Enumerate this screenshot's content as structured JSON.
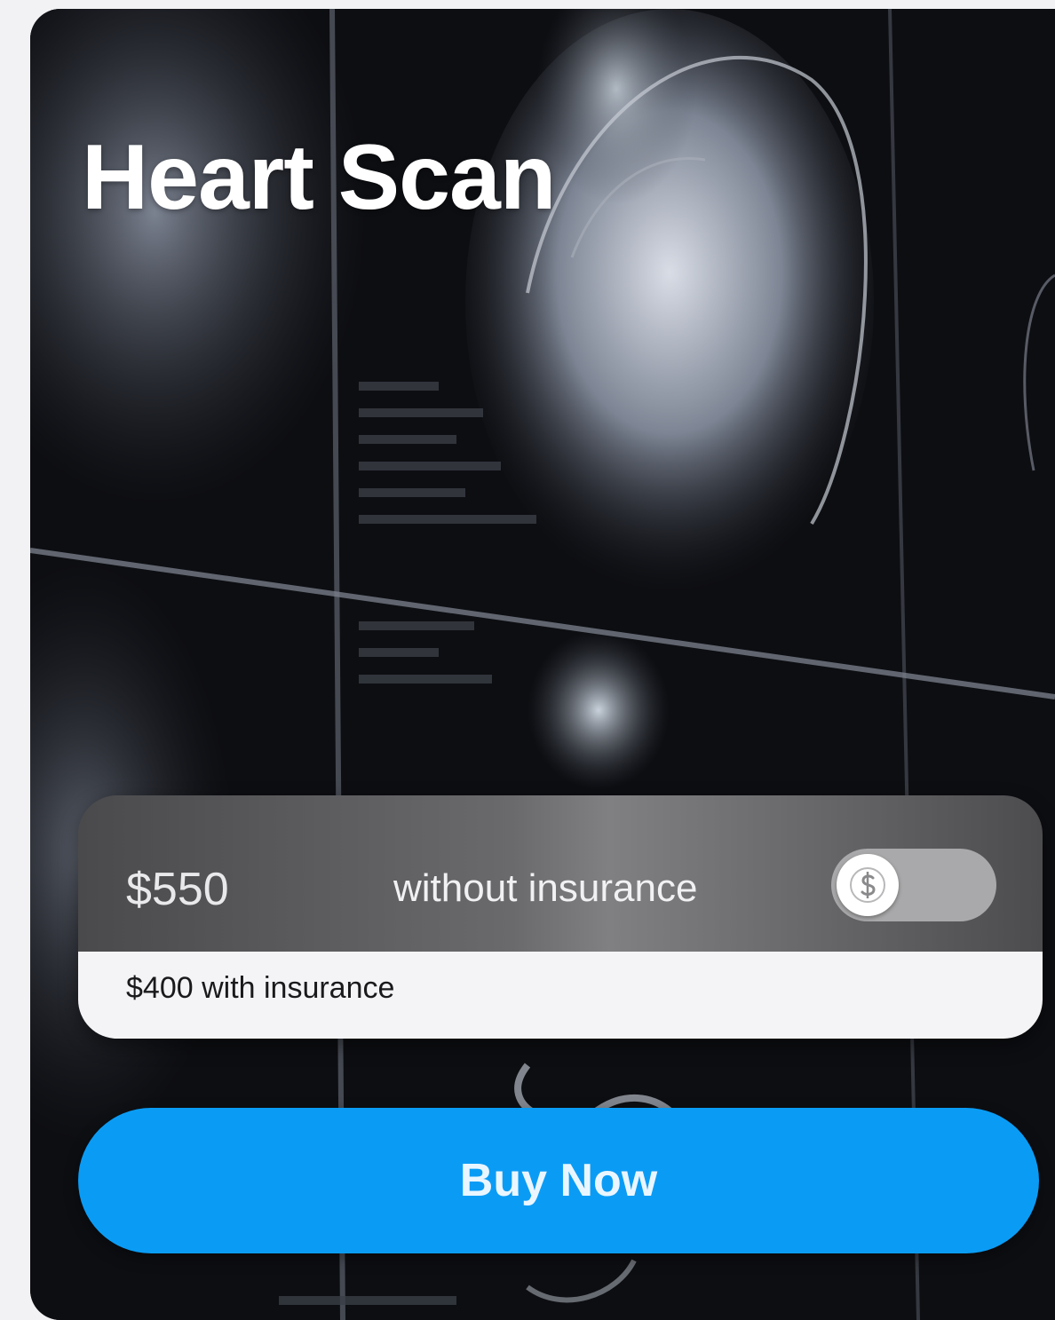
{
  "product": {
    "title": "Heart Scan",
    "price_without_insurance": "$550",
    "without_insurance_label": "without insurance",
    "price_with_insurance_text": "$400 with insurance",
    "insurance_toggle_on": false,
    "toggle_icon": "dollar-sign-icon"
  },
  "actions": {
    "buy_label": "Buy Now"
  },
  "colors": {
    "buy_button": "#0a9cf5",
    "card_background": "#0c0d10",
    "panel_light": "#f4f4f6"
  }
}
